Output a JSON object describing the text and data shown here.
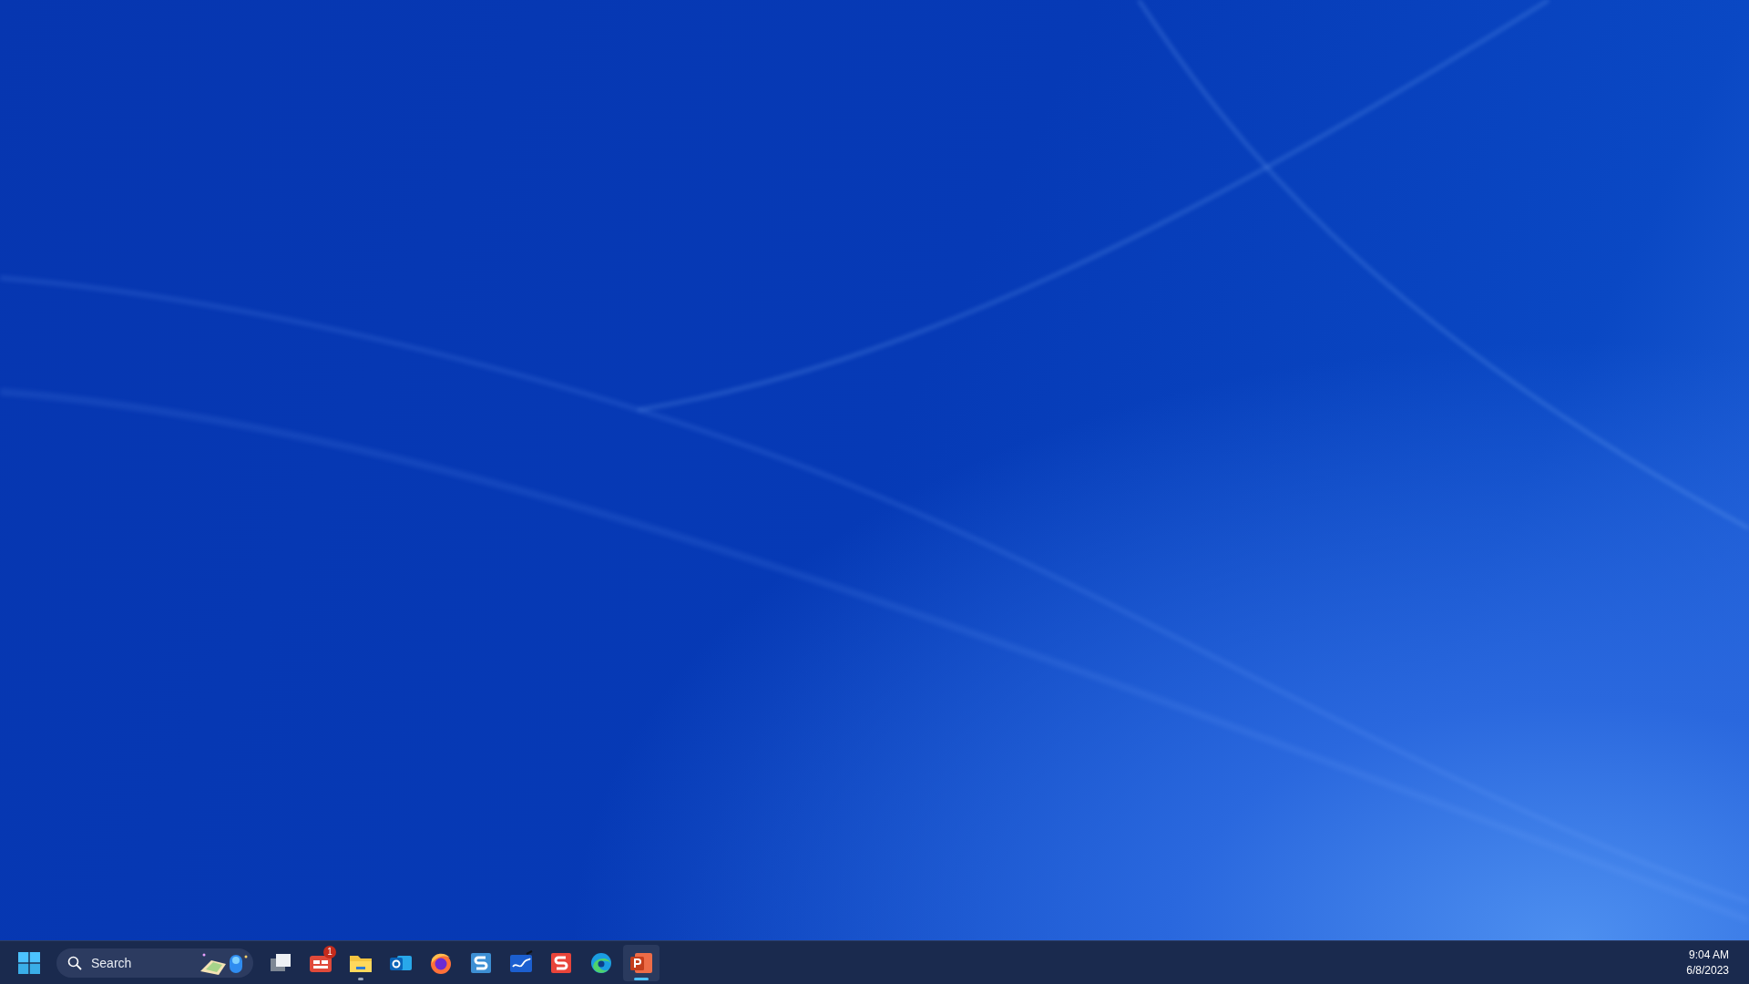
{
  "taskbar": {
    "search": {
      "placeholder": "Search"
    },
    "apps": [
      {
        "kind": "taskview",
        "running": false,
        "selected": false
      },
      {
        "kind": "news",
        "running": false,
        "selected": false,
        "badge": "1"
      },
      {
        "kind": "explorer",
        "running": true,
        "selected": false
      },
      {
        "kind": "mail",
        "running": false,
        "selected": false
      },
      {
        "kind": "browser-fox",
        "running": false,
        "selected": false
      },
      {
        "kind": "s-blue",
        "running": false,
        "selected": false
      },
      {
        "kind": "whiteboard",
        "running": false,
        "selected": false
      },
      {
        "kind": "s-red",
        "running": false,
        "selected": false
      },
      {
        "kind": "browser-wave",
        "running": false,
        "selected": false
      },
      {
        "kind": "slides",
        "running": true,
        "selected": true
      }
    ],
    "clock": {
      "time": "9:04 AM",
      "date": "6/8/2023"
    }
  }
}
